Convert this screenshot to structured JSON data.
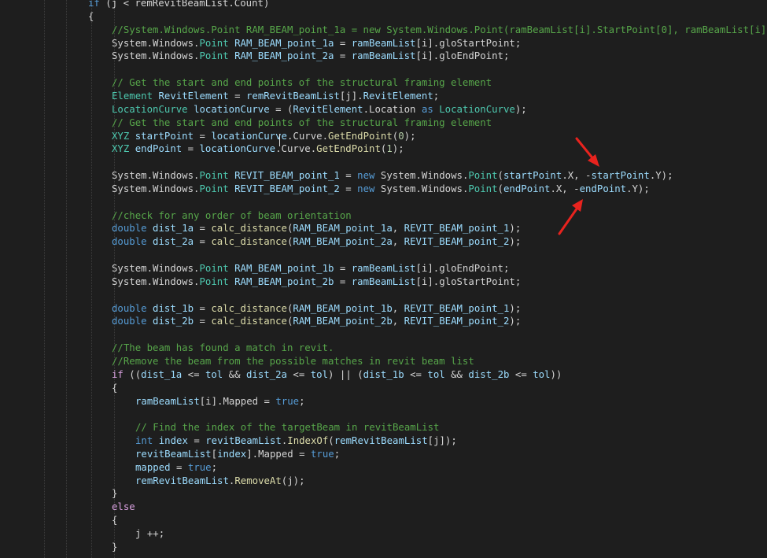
{
  "editor": {
    "lines": [
      {
        "indent": 112,
        "tokens": [
          [
            "kw",
            "if"
          ],
          [
            "plain",
            " (j < remRevitBeamList.Count)"
          ]
        ]
      },
      {
        "indent": 112,
        "tokens": [
          [
            "plain",
            "{"
          ]
        ]
      },
      {
        "indent": 142,
        "tokens": [
          [
            "com",
            "//System.Windows.Point RAM_BEAM_point_1a = new System.Windows.Point(ramBeamList[i].StartPoint[0], ramBeamList[i]"
          ]
        ]
      },
      {
        "indent": 142,
        "tokens": [
          [
            "plain",
            "System.Windows."
          ],
          [
            "type",
            "Point"
          ],
          [
            "plain",
            " "
          ],
          [
            "var",
            "RAM_BEAM_point_1a"
          ],
          [
            "plain",
            " = "
          ],
          [
            "var",
            "ramBeamList"
          ],
          [
            "plain",
            "[i].gloStartPoint;"
          ]
        ]
      },
      {
        "indent": 142,
        "tokens": [
          [
            "plain",
            "System.Windows."
          ],
          [
            "type",
            "Point"
          ],
          [
            "plain",
            " "
          ],
          [
            "var",
            "RAM_BEAM_point_2a"
          ],
          [
            "plain",
            " = "
          ],
          [
            "var",
            "ramBeamList"
          ],
          [
            "plain",
            "[i].gloEndPoint;"
          ]
        ]
      },
      {
        "indent": 142,
        "tokens": []
      },
      {
        "indent": 142,
        "tokens": [
          [
            "com",
            "// Get the start and end points of the structural framing element"
          ]
        ]
      },
      {
        "indent": 142,
        "tokens": [
          [
            "type",
            "Element"
          ],
          [
            "plain",
            " "
          ],
          [
            "var",
            "RevitElement"
          ],
          [
            "plain",
            " = "
          ],
          [
            "var",
            "remRevitBeamList"
          ],
          [
            "plain",
            "[j]."
          ],
          [
            "var",
            "RevitElement"
          ],
          [
            "plain",
            ";"
          ]
        ]
      },
      {
        "indent": 142,
        "tokens": [
          [
            "type",
            "LocationCurve"
          ],
          [
            "plain",
            " "
          ],
          [
            "var",
            "locationCurve"
          ],
          [
            "plain",
            " = ("
          ],
          [
            "var",
            "RevitElement"
          ],
          [
            "plain",
            ".Location "
          ],
          [
            "kw",
            "as"
          ],
          [
            "plain",
            " "
          ],
          [
            "type",
            "LocationCurve"
          ],
          [
            "plain",
            ");"
          ]
        ]
      },
      {
        "indent": 142,
        "tokens": [
          [
            "com",
            "// Get the start and end points of the structural framing element"
          ]
        ]
      },
      {
        "indent": 142,
        "tokens": [
          [
            "type",
            "XYZ"
          ],
          [
            "plain",
            " "
          ],
          [
            "var",
            "startPoint"
          ],
          [
            "plain",
            " = "
          ],
          [
            "var",
            "locationCurve"
          ],
          [
            "plain",
            ".Curve."
          ],
          [
            "fn",
            "GetEndPoint"
          ],
          [
            "plain",
            "("
          ],
          [
            "num",
            "0"
          ],
          [
            "plain",
            ");"
          ]
        ]
      },
      {
        "indent": 142,
        "tokens": [
          [
            "type",
            "XYZ"
          ],
          [
            "plain",
            " "
          ],
          [
            "var",
            "endPoint"
          ],
          [
            "plain",
            " = "
          ],
          [
            "var",
            "locationCurve"
          ],
          [
            "plain",
            ".Curve."
          ],
          [
            "fn",
            "GetEndPoint"
          ],
          [
            "plain",
            "("
          ],
          [
            "num",
            "1"
          ],
          [
            "plain",
            ");"
          ]
        ]
      },
      {
        "indent": 142,
        "tokens": []
      },
      {
        "indent": 142,
        "tokens": [
          [
            "plain",
            "System.Windows."
          ],
          [
            "type",
            "Point"
          ],
          [
            "plain",
            " "
          ],
          [
            "var",
            "REVIT_BEAM_point_1"
          ],
          [
            "plain",
            " = "
          ],
          [
            "kw",
            "new"
          ],
          [
            "plain",
            " System.Windows."
          ],
          [
            "type",
            "Point"
          ],
          [
            "plain",
            "("
          ],
          [
            "var",
            "startPoint"
          ],
          [
            "plain",
            ".X, -"
          ],
          [
            "var",
            "startPoint"
          ],
          [
            "plain",
            ".Y);"
          ]
        ]
      },
      {
        "indent": 142,
        "tokens": [
          [
            "plain",
            "System.Windows."
          ],
          [
            "type",
            "Point"
          ],
          [
            "plain",
            " "
          ],
          [
            "var",
            "REVIT_BEAM_point_2"
          ],
          [
            "plain",
            " = "
          ],
          [
            "kw",
            "new"
          ],
          [
            "plain",
            " System.Windows."
          ],
          [
            "type",
            "Point"
          ],
          [
            "plain",
            "("
          ],
          [
            "var",
            "endPoint"
          ],
          [
            "plain",
            ".X, -"
          ],
          [
            "var",
            "endPoint"
          ],
          [
            "plain",
            ".Y);"
          ]
        ]
      },
      {
        "indent": 142,
        "tokens": []
      },
      {
        "indent": 142,
        "tokens": [
          [
            "com",
            "//check for any order of beam orientation"
          ]
        ]
      },
      {
        "indent": 142,
        "tokens": [
          [
            "kw",
            "double"
          ],
          [
            "plain",
            " "
          ],
          [
            "var",
            "dist_1a"
          ],
          [
            "plain",
            " = "
          ],
          [
            "fn",
            "calc_distance"
          ],
          [
            "plain",
            "("
          ],
          [
            "var",
            "RAM_BEAM_point_1a"
          ],
          [
            "plain",
            ", "
          ],
          [
            "var",
            "REVIT_BEAM_point_1"
          ],
          [
            "plain",
            ");"
          ]
        ]
      },
      {
        "indent": 142,
        "tokens": [
          [
            "kw",
            "double"
          ],
          [
            "plain",
            " "
          ],
          [
            "var",
            "dist_2a"
          ],
          [
            "plain",
            " = "
          ],
          [
            "fn",
            "calc_distance"
          ],
          [
            "plain",
            "("
          ],
          [
            "var",
            "RAM_BEAM_point_2a"
          ],
          [
            "plain",
            ", "
          ],
          [
            "var",
            "REVIT_BEAM_point_2"
          ],
          [
            "plain",
            ");"
          ]
        ]
      },
      {
        "indent": 142,
        "tokens": []
      },
      {
        "indent": 142,
        "tokens": [
          [
            "plain",
            "System.Windows."
          ],
          [
            "type",
            "Point"
          ],
          [
            "plain",
            " "
          ],
          [
            "var",
            "RAM_BEAM_point_1b"
          ],
          [
            "plain",
            " = "
          ],
          [
            "var",
            "ramBeamList"
          ],
          [
            "plain",
            "[i].gloEndPoint;"
          ]
        ]
      },
      {
        "indent": 142,
        "tokens": [
          [
            "plain",
            "System.Windows."
          ],
          [
            "type",
            "Point"
          ],
          [
            "plain",
            " "
          ],
          [
            "var",
            "RAM_BEAM_point_2b"
          ],
          [
            "plain",
            " = "
          ],
          [
            "var",
            "ramBeamList"
          ],
          [
            "plain",
            "[i].gloStartPoint;"
          ]
        ]
      },
      {
        "indent": 142,
        "tokens": []
      },
      {
        "indent": 142,
        "tokens": [
          [
            "kw",
            "double"
          ],
          [
            "plain",
            " "
          ],
          [
            "var",
            "dist_1b"
          ],
          [
            "plain",
            " = "
          ],
          [
            "fn",
            "calc_distance"
          ],
          [
            "plain",
            "("
          ],
          [
            "var",
            "RAM_BEAM_point_1b"
          ],
          [
            "plain",
            ", "
          ],
          [
            "var",
            "REVIT_BEAM_point_1"
          ],
          [
            "plain",
            ");"
          ]
        ]
      },
      {
        "indent": 142,
        "tokens": [
          [
            "kw",
            "double"
          ],
          [
            "plain",
            " "
          ],
          [
            "var",
            "dist_2b"
          ],
          [
            "plain",
            " = "
          ],
          [
            "fn",
            "calc_distance"
          ],
          [
            "plain",
            "("
          ],
          [
            "var",
            "RAM_BEAM_point_2b"
          ],
          [
            "plain",
            ", "
          ],
          [
            "var",
            "REVIT_BEAM_point_2"
          ],
          [
            "plain",
            ");"
          ]
        ]
      },
      {
        "indent": 142,
        "tokens": []
      },
      {
        "indent": 142,
        "tokens": [
          [
            "com",
            "//The beam has found a match in revit."
          ]
        ]
      },
      {
        "indent": 142,
        "tokens": [
          [
            "com",
            "//Remove the beam from the possible matches in revit beam list"
          ]
        ]
      },
      {
        "indent": 142,
        "tokens": [
          [
            "ctl",
            "if"
          ],
          [
            "plain",
            " (("
          ],
          [
            "var",
            "dist_1a"
          ],
          [
            "plain",
            " <= "
          ],
          [
            "var",
            "tol"
          ],
          [
            "plain",
            " && "
          ],
          [
            "var",
            "dist_2a"
          ],
          [
            "plain",
            " <= "
          ],
          [
            "var",
            "tol"
          ],
          [
            "plain",
            ") || ("
          ],
          [
            "var",
            "dist_1b"
          ],
          [
            "plain",
            " <= "
          ],
          [
            "var",
            "tol"
          ],
          [
            "plain",
            " && "
          ],
          [
            "var",
            "dist_2b"
          ],
          [
            "plain",
            " <= "
          ],
          [
            "var",
            "tol"
          ],
          [
            "plain",
            "))"
          ]
        ]
      },
      {
        "indent": 142,
        "tokens": [
          [
            "plain",
            "{"
          ]
        ]
      },
      {
        "indent": 172,
        "tokens": [
          [
            "var",
            "ramBeamList"
          ],
          [
            "plain",
            "[i].Mapped = "
          ],
          [
            "kw",
            "true"
          ],
          [
            "plain",
            ";"
          ]
        ]
      },
      {
        "indent": 172,
        "tokens": []
      },
      {
        "indent": 172,
        "tokens": [
          [
            "com",
            "// Find the index of the targetBeam in revitBeamList"
          ]
        ]
      },
      {
        "indent": 172,
        "tokens": [
          [
            "kw",
            "int"
          ],
          [
            "plain",
            " "
          ],
          [
            "var",
            "index"
          ],
          [
            "plain",
            " = "
          ],
          [
            "var",
            "revitBeamList"
          ],
          [
            "plain",
            "."
          ],
          [
            "fn",
            "IndexOf"
          ],
          [
            "plain",
            "("
          ],
          [
            "var",
            "remRevitBeamList"
          ],
          [
            "plain",
            "[j]);"
          ]
        ]
      },
      {
        "indent": 172,
        "tokens": [
          [
            "var",
            "revitBeamList"
          ],
          [
            "plain",
            "["
          ],
          [
            "var",
            "index"
          ],
          [
            "plain",
            "].Mapped = "
          ],
          [
            "kw",
            "true"
          ],
          [
            "plain",
            ";"
          ]
        ]
      },
      {
        "indent": 172,
        "tokens": [
          [
            "var",
            "mapped"
          ],
          [
            "plain",
            " = "
          ],
          [
            "kw",
            "true"
          ],
          [
            "plain",
            ";"
          ]
        ]
      },
      {
        "indent": 172,
        "tokens": [
          [
            "var",
            "remRevitBeamList"
          ],
          [
            "plain",
            "."
          ],
          [
            "fn",
            "RemoveAt"
          ],
          [
            "plain",
            "(j);"
          ]
        ]
      },
      {
        "indent": 142,
        "tokens": [
          [
            "plain",
            "}"
          ]
        ]
      },
      {
        "indent": 142,
        "tokens": [
          [
            "ctl",
            "else"
          ]
        ]
      },
      {
        "indent": 142,
        "tokens": [
          [
            "plain",
            "{"
          ]
        ]
      },
      {
        "indent": 172,
        "tokens": [
          [
            "plain",
            "j ++;"
          ]
        ]
      },
      {
        "indent": 142,
        "tokens": [
          [
            "plain",
            "}"
          ]
        ]
      }
    ]
  },
  "colors": {
    "background": "#1e1e1e",
    "arrow": "#e8231e"
  }
}
